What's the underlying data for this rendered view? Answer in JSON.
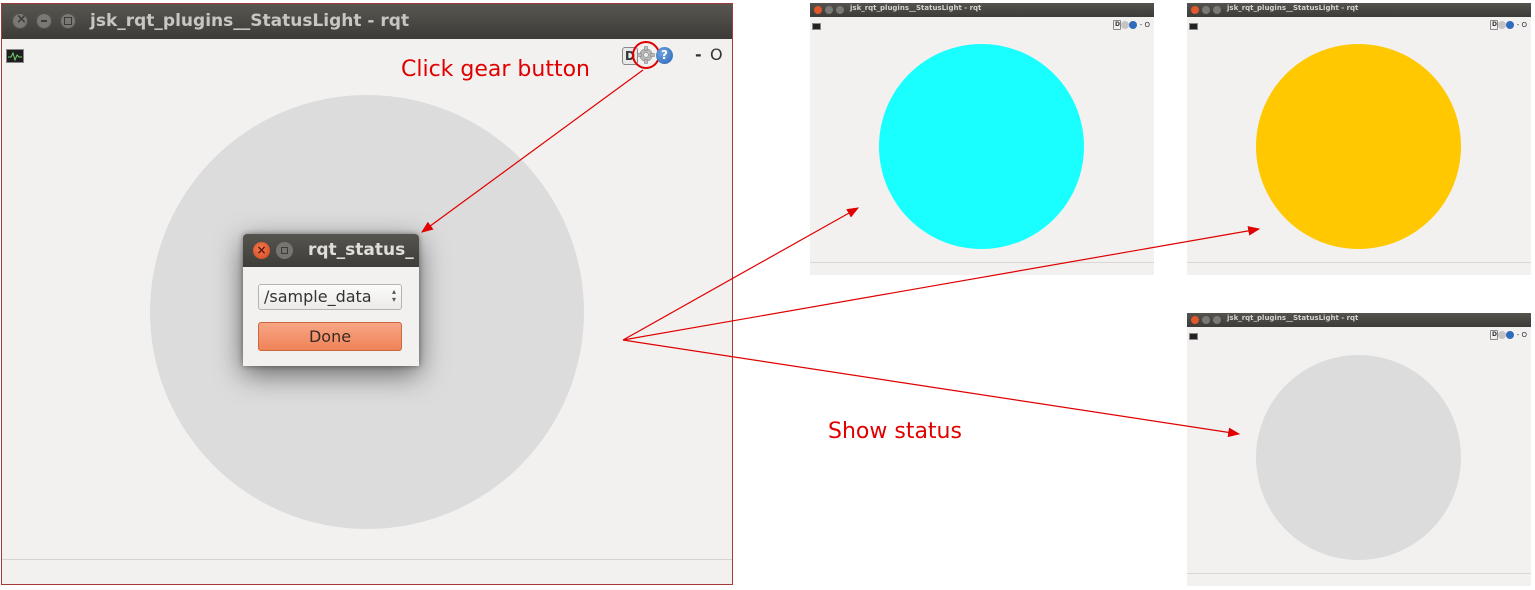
{
  "main_window": {
    "title": "jsk_rqt_plugins__StatusLight - rqt",
    "toolbar": {
      "d_label": "D",
      "help_label": "?",
      "minimize_label": "-",
      "restore_label": "O"
    },
    "status_color": "#dcdcdc"
  },
  "dialog": {
    "title": "rqt_status_",
    "topic_value": "/sample_data",
    "done_label": "Done"
  },
  "thumbnails": [
    {
      "title": "jsk_rqt_plugins__StatusLight - rqt",
      "status_color": "#19ffff"
    },
    {
      "title": "jsk_rqt_plugins__StatusLight - rqt",
      "status_color": "#ffc800"
    },
    {
      "title": "jsk_rqt_plugins__StatusLight - rqt",
      "status_color": "#dcdcdc"
    }
  ],
  "thumb_tools": {
    "d_label": "D",
    "minimize_label": "-",
    "restore_label": "O"
  },
  "annotations": {
    "gear_note": "Click gear button",
    "status_note": "Show status",
    "color": "#e00000"
  }
}
